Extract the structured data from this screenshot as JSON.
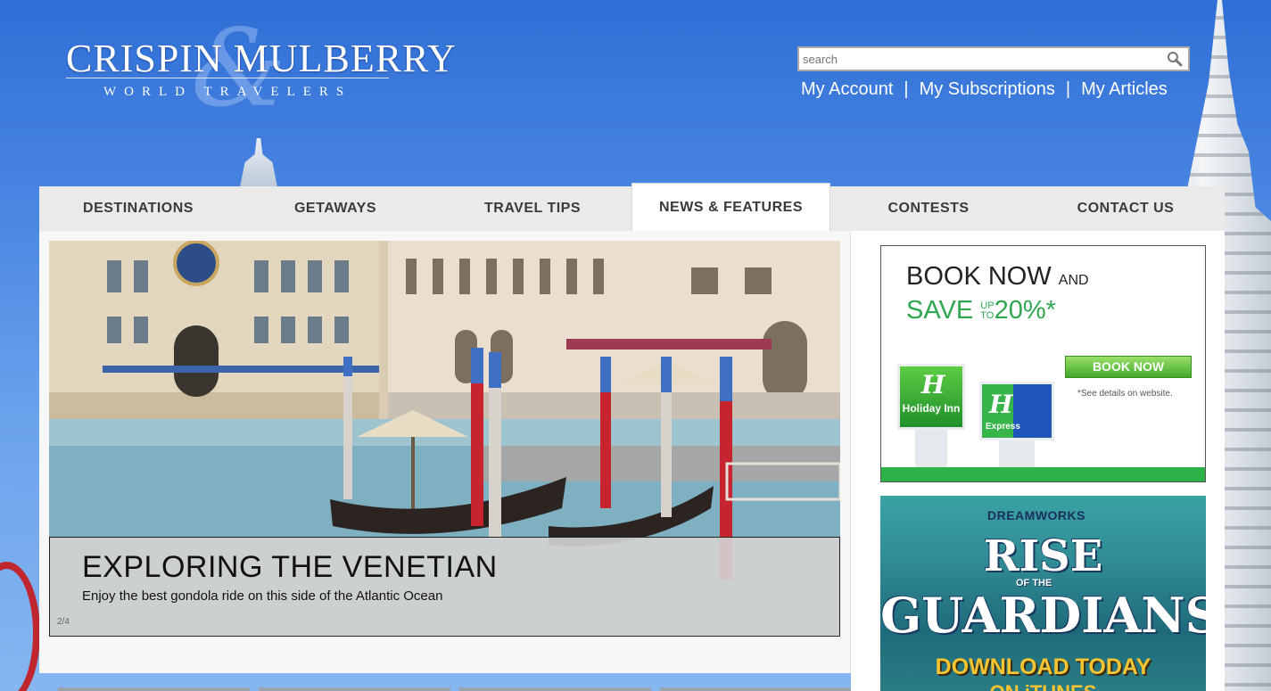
{
  "brand": {
    "name": "CRISPIN MULBERRY",
    "ampersand": "&",
    "tagline": "WORLD TRAVELERS"
  },
  "search": {
    "placeholder": "search",
    "icon": "magnifier-icon"
  },
  "account_links": [
    {
      "label": "My Account"
    },
    {
      "label": "My Subscriptions"
    },
    {
      "label": "My Articles"
    }
  ],
  "account_separator": "|",
  "nav": {
    "active_index": 3,
    "items": [
      {
        "label": "DESTINATIONS"
      },
      {
        "label": "GETAWAYS"
      },
      {
        "label": "TRAVEL TIPS"
      },
      {
        "label": "NEWS & FEATURES"
      },
      {
        "label": "CONTESTS"
      },
      {
        "label": "CONTACT US"
      }
    ]
  },
  "hero": {
    "title": "EXPLORING THE VENETIAN",
    "subtitle": "Enjoy the best gondola ride on this side of the Atlantic Ocean",
    "counter": "2/4"
  },
  "ads": {
    "holiday_inn": {
      "line1_big": "BOOK NOW",
      "line1_small": "AND",
      "line2_save": "SAVE",
      "line2_up": "UP",
      "line2_to": "TO",
      "line2_pct": "20%*",
      "button": "BOOK NOW",
      "note": "*See details on website.",
      "sign1": "Holiday Inn",
      "sign2": "Express",
      "brand_color": "#2fa84f"
    },
    "movie": {
      "brand": "DREAMWORKS",
      "title_top": "RISE",
      "title_mid": "OF THE",
      "title_main": "GUARDIANS",
      "cta": "DOWNLOAD TODAY",
      "cta2": "ON iTUNES"
    }
  },
  "colors": {
    "sky": "#3b7ad9",
    "nav_bg": "#eaeaea",
    "nav_text": "#3a3a3a"
  }
}
